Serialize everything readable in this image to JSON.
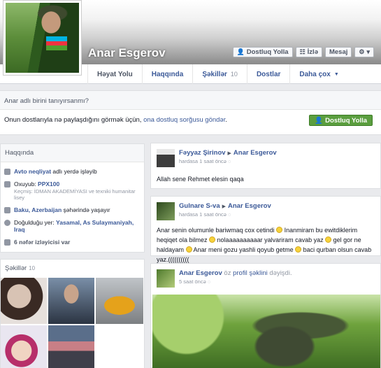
{
  "profile": {
    "name": "Anar Esgerov"
  },
  "cover_buttons": [
    {
      "label": "Dostluq Yolla",
      "icon": "add-friend-icon"
    },
    {
      "label": "İzlə",
      "icon": "rss-icon"
    },
    {
      "label": "Mesaj",
      "icon": ""
    },
    {
      "label": "",
      "icon": "gear-icon"
    }
  ],
  "tabs": [
    {
      "label": "Həyat Yolu",
      "active": true
    },
    {
      "label": "Haqqında"
    },
    {
      "label": "Şəkillər",
      "count": "10"
    },
    {
      "label": "Dostlar"
    },
    {
      "label": "Daha çox"
    }
  ],
  "know_box": {
    "question": "Anar adlı birini tanıyırsanmı?",
    "text_before": "Onun dostlarıyla nə paylaşdığını görmək üçün, ",
    "link": "ona dostluq sorğusu göndər",
    "text_after": ".",
    "button": "Dostluq Yolla"
  },
  "about": {
    "title": "Haqqında",
    "items": [
      {
        "icon": "briefcase-icon",
        "bold": "Avto neqliyat",
        "rest": " adlı yerdə işləyib"
      },
      {
        "icon": "school-icon",
        "prefix": "Oxuyub: ",
        "bold": "PPX100",
        "sub": "Keçmiş: İDMAN AKADEMİYASI ve texniki humanitar lisey"
      },
      {
        "icon": "home-icon",
        "bold": "Baku, Azerbaijan",
        "rest": " şəhərində yaşayır"
      },
      {
        "icon": "pin-icon",
        "prefix": "Doğulduğu yer: ",
        "bold": "Yasamal, As Sulaymaniyah, Iraq"
      },
      {
        "icon": "followers-icon",
        "bold": "6 nəfər izləyicisi var"
      }
    ]
  },
  "photos": {
    "title": "Şəkillər",
    "count": "10"
  },
  "posts": [
    {
      "author": "Fəyyaz Şirinov",
      "target": "Anar Esgerov",
      "time": "hardasa 1 saat öncə",
      "body": "Allah sene Rehmet elesin qaqa"
    },
    {
      "author": "Gulnare S-va",
      "target": "Anar Esgerov",
      "time": "hardasa 1 saat öncə",
      "body_parts": [
        "Anar senin olumunle bariwmaq cox cetindi ",
        " Inanmiram bu ewitdiklerim heqiqet ola bilmez ",
        " nolaaaaaaaaaar yalvariram cavab yaz ",
        " gel gor ne haldayam ",
        " Anar meni gozu yashli qoyub getme ",
        " baci qurban olsun cavab yaz.(((((((((("
      ]
    },
    {
      "author": "Anar Esgerov",
      "verb_before": " öz ",
      "link": "profil şəklini",
      "verb_after": " dəyişdi.",
      "time": "5 saat öncə"
    }
  ],
  "colors": {
    "link": "#3b5998",
    "green_button": "#5b9e3f",
    "flag": [
      "#00b5e2",
      "#ef3340",
      "#509e2f"
    ]
  }
}
